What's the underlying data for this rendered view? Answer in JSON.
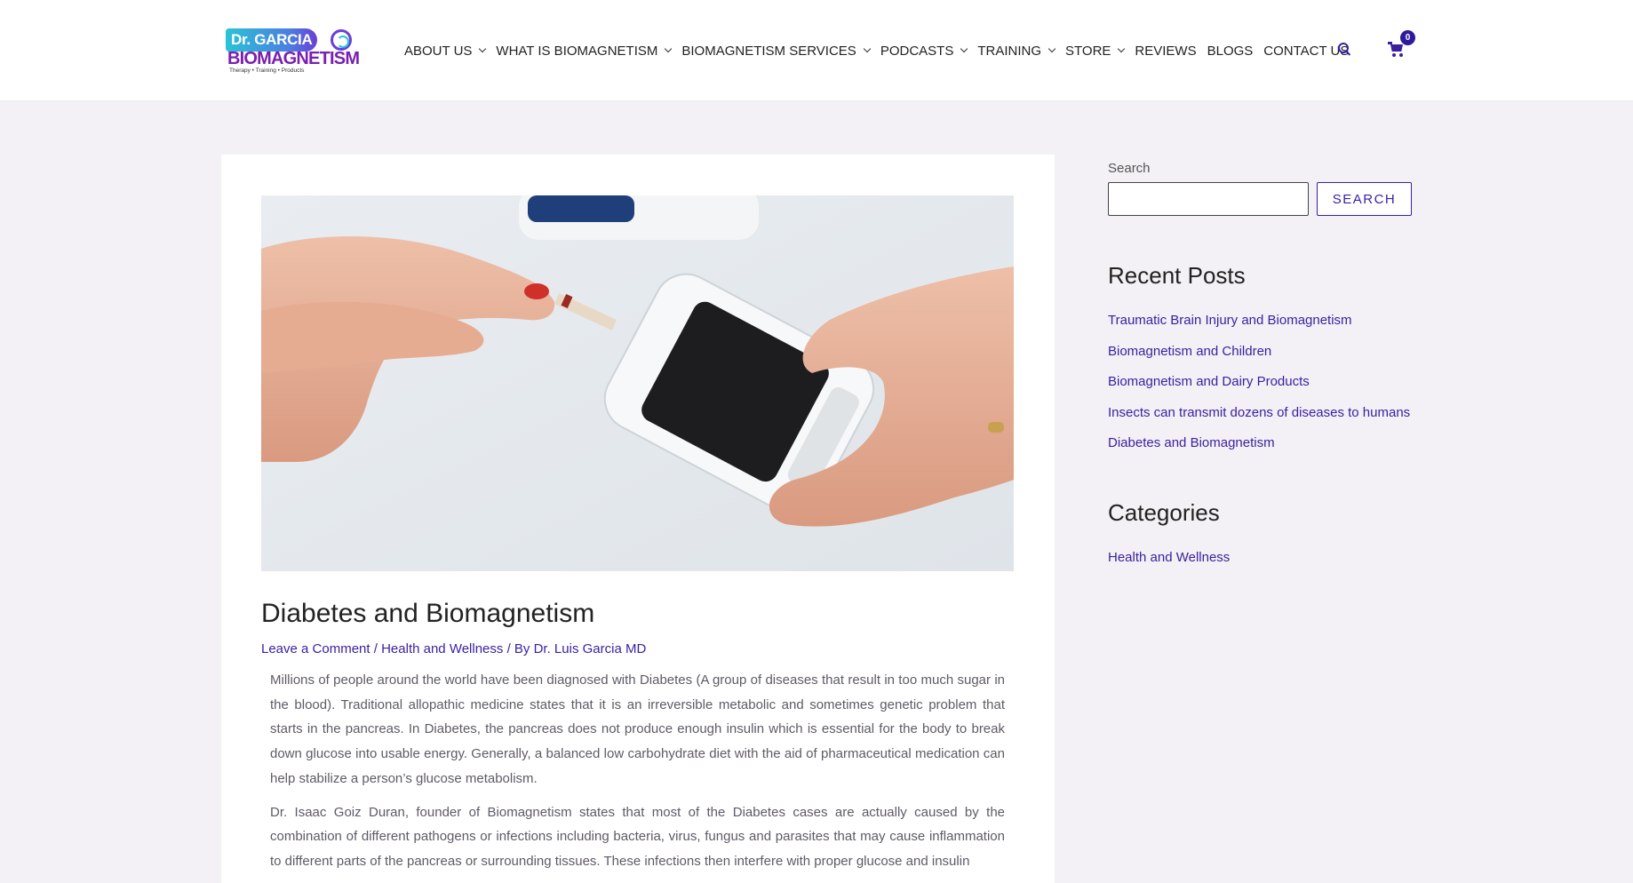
{
  "header": {
    "logo": {
      "line1": "Dr. GARCIA",
      "line2": "BIOMAGNETISM",
      "tagline": "Therapy • Training • Products"
    },
    "nav": [
      {
        "label": "ABOUT US",
        "has_dropdown": true
      },
      {
        "label": "WHAT IS BIOMAGNETISM",
        "has_dropdown": true
      },
      {
        "label": "BIOMAGNETISM SERVICES",
        "has_dropdown": true
      },
      {
        "label": "PODCASTS",
        "has_dropdown": true
      },
      {
        "label": "TRAINING",
        "has_dropdown": true
      },
      {
        "label": "STORE",
        "has_dropdown": true
      },
      {
        "label": "REVIEWS",
        "has_dropdown": false
      },
      {
        "label": "BLOGS",
        "has_dropdown": false
      },
      {
        "label": "CONTACT US",
        "has_dropdown": false
      }
    ],
    "search_icon": "search-icon",
    "cart": {
      "icon": "cart-icon",
      "count": "0"
    }
  },
  "article": {
    "image_alt": "blood glucose meter test",
    "title": "Diabetes and Biomagnetism",
    "meta": {
      "comment_link": "Leave a Comment",
      "sep1": " / ",
      "category": "Health and Wellness",
      "by": " / By ",
      "author": "Dr. Luis Garcia MD"
    },
    "paragraphs": [
      "Millions of people around the world have been diagnosed with Diabetes (A group of diseases that result in too much sugar in the blood). Traditional allopathic medicine states that it is an irreversible metabolic and sometimes genetic problem that starts in the pancreas. In Diabetes, the pancreas does not produce enough insulin which is essential for the body to break down glucose into usable energy. Generally, a balanced low carbohydrate diet with the aid of pharmaceutical medication can help stabilize a person’s glucose metabolism.",
      "Dr. Isaac Goiz Duran, founder of Biomagnetism states that most of the Diabetes cases are actually caused by the combination of different pathogens or infections including bacteria, virus, fungus and parasites that may cause inflammation to different parts of the pancreas or surrounding tissues. These infections then interfere with proper glucose and insulin"
    ]
  },
  "sidebar": {
    "search": {
      "label": "Search",
      "value": "",
      "button": "SEARCH"
    },
    "recent_posts": {
      "heading": "Recent Posts",
      "items": [
        "Traumatic Brain Injury and Biomagnetism",
        "Biomagnetism and Children",
        "Biomagnetism and Dairy Products",
        "Insects can transmit dozens of diseases to humans",
        "Diabetes and Biomagnetism"
      ]
    },
    "categories": {
      "heading": "Categories",
      "items": [
        "Health and Wellness"
      ]
    }
  },
  "colors": {
    "accent": "#3a1fa0",
    "page_bg": "#f3f1f5",
    "logo_purple": "#7a1fb0",
    "logo_teal": "#2bc3d6"
  }
}
